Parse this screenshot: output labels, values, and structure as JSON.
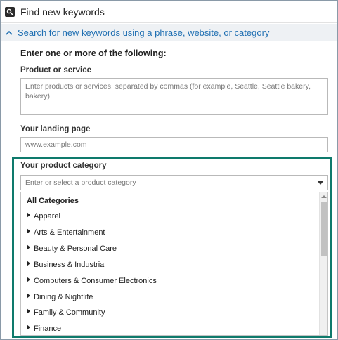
{
  "window": {
    "title": "Find new keywords",
    "title_icon": "search-icon"
  },
  "section": {
    "label": "Search for new keywords using a phrase, website, or category",
    "icon": "chevron-up-icon"
  },
  "form": {
    "heading": "Enter one or more of the following:",
    "product_label": "Product or service",
    "product_placeholder": "Enter products or services, separated by commas (for example, Seattle, Seattle bakery, bakery).",
    "landing_label": "Your landing page",
    "landing_placeholder": "www.example.com",
    "category_label": "Your product category",
    "category_placeholder": "Enter or select a product category"
  },
  "category_list": {
    "header": "All Categories",
    "items": [
      "Apparel",
      "Arts & Entertainment",
      "Beauty & Personal Care",
      "Business & Industrial",
      "Computers & Consumer Electronics",
      "Dining & Nightlife",
      "Family & Community",
      "Finance"
    ]
  },
  "colors": {
    "link": "#1f6fb2",
    "highlight": "#0e7a6c",
    "section_bg": "#eef1f4"
  }
}
